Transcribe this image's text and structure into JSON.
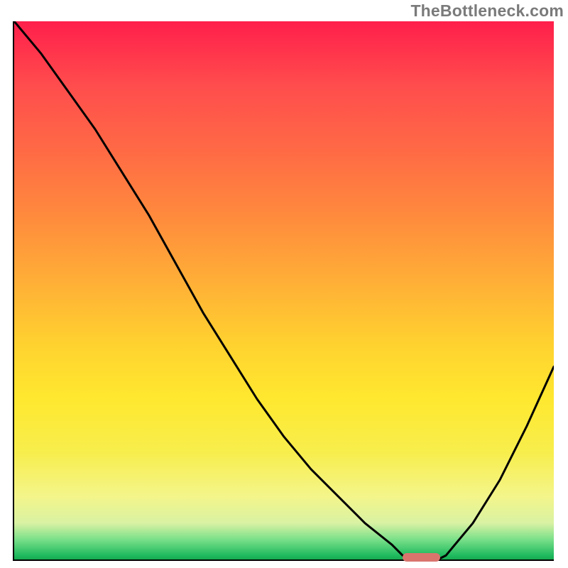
{
  "watermark": "TheBottleneck.com",
  "colors": {
    "curve": "#000000",
    "marker": "#d9746d",
    "gradient_top": "#ff1f4b",
    "gradient_bottom": "#16a34a"
  },
  "chart_data": {
    "type": "line",
    "title": "",
    "xlabel": "",
    "ylabel": "",
    "xlim": [
      0,
      100
    ],
    "ylim": [
      0,
      100
    ],
    "x": [
      0,
      5,
      10,
      15,
      20,
      25,
      30,
      35,
      40,
      45,
      50,
      55,
      60,
      65,
      70,
      72,
      75,
      78,
      80,
      85,
      90,
      95,
      100
    ],
    "values": [
      100,
      94,
      87,
      80,
      72,
      64,
      55,
      46,
      38,
      30,
      23,
      17,
      12,
      7,
      3,
      1,
      0,
      0,
      1,
      7,
      15,
      25,
      36
    ],
    "optimal_range_x": [
      72,
      79
    ],
    "marker_y": 0.6
  }
}
